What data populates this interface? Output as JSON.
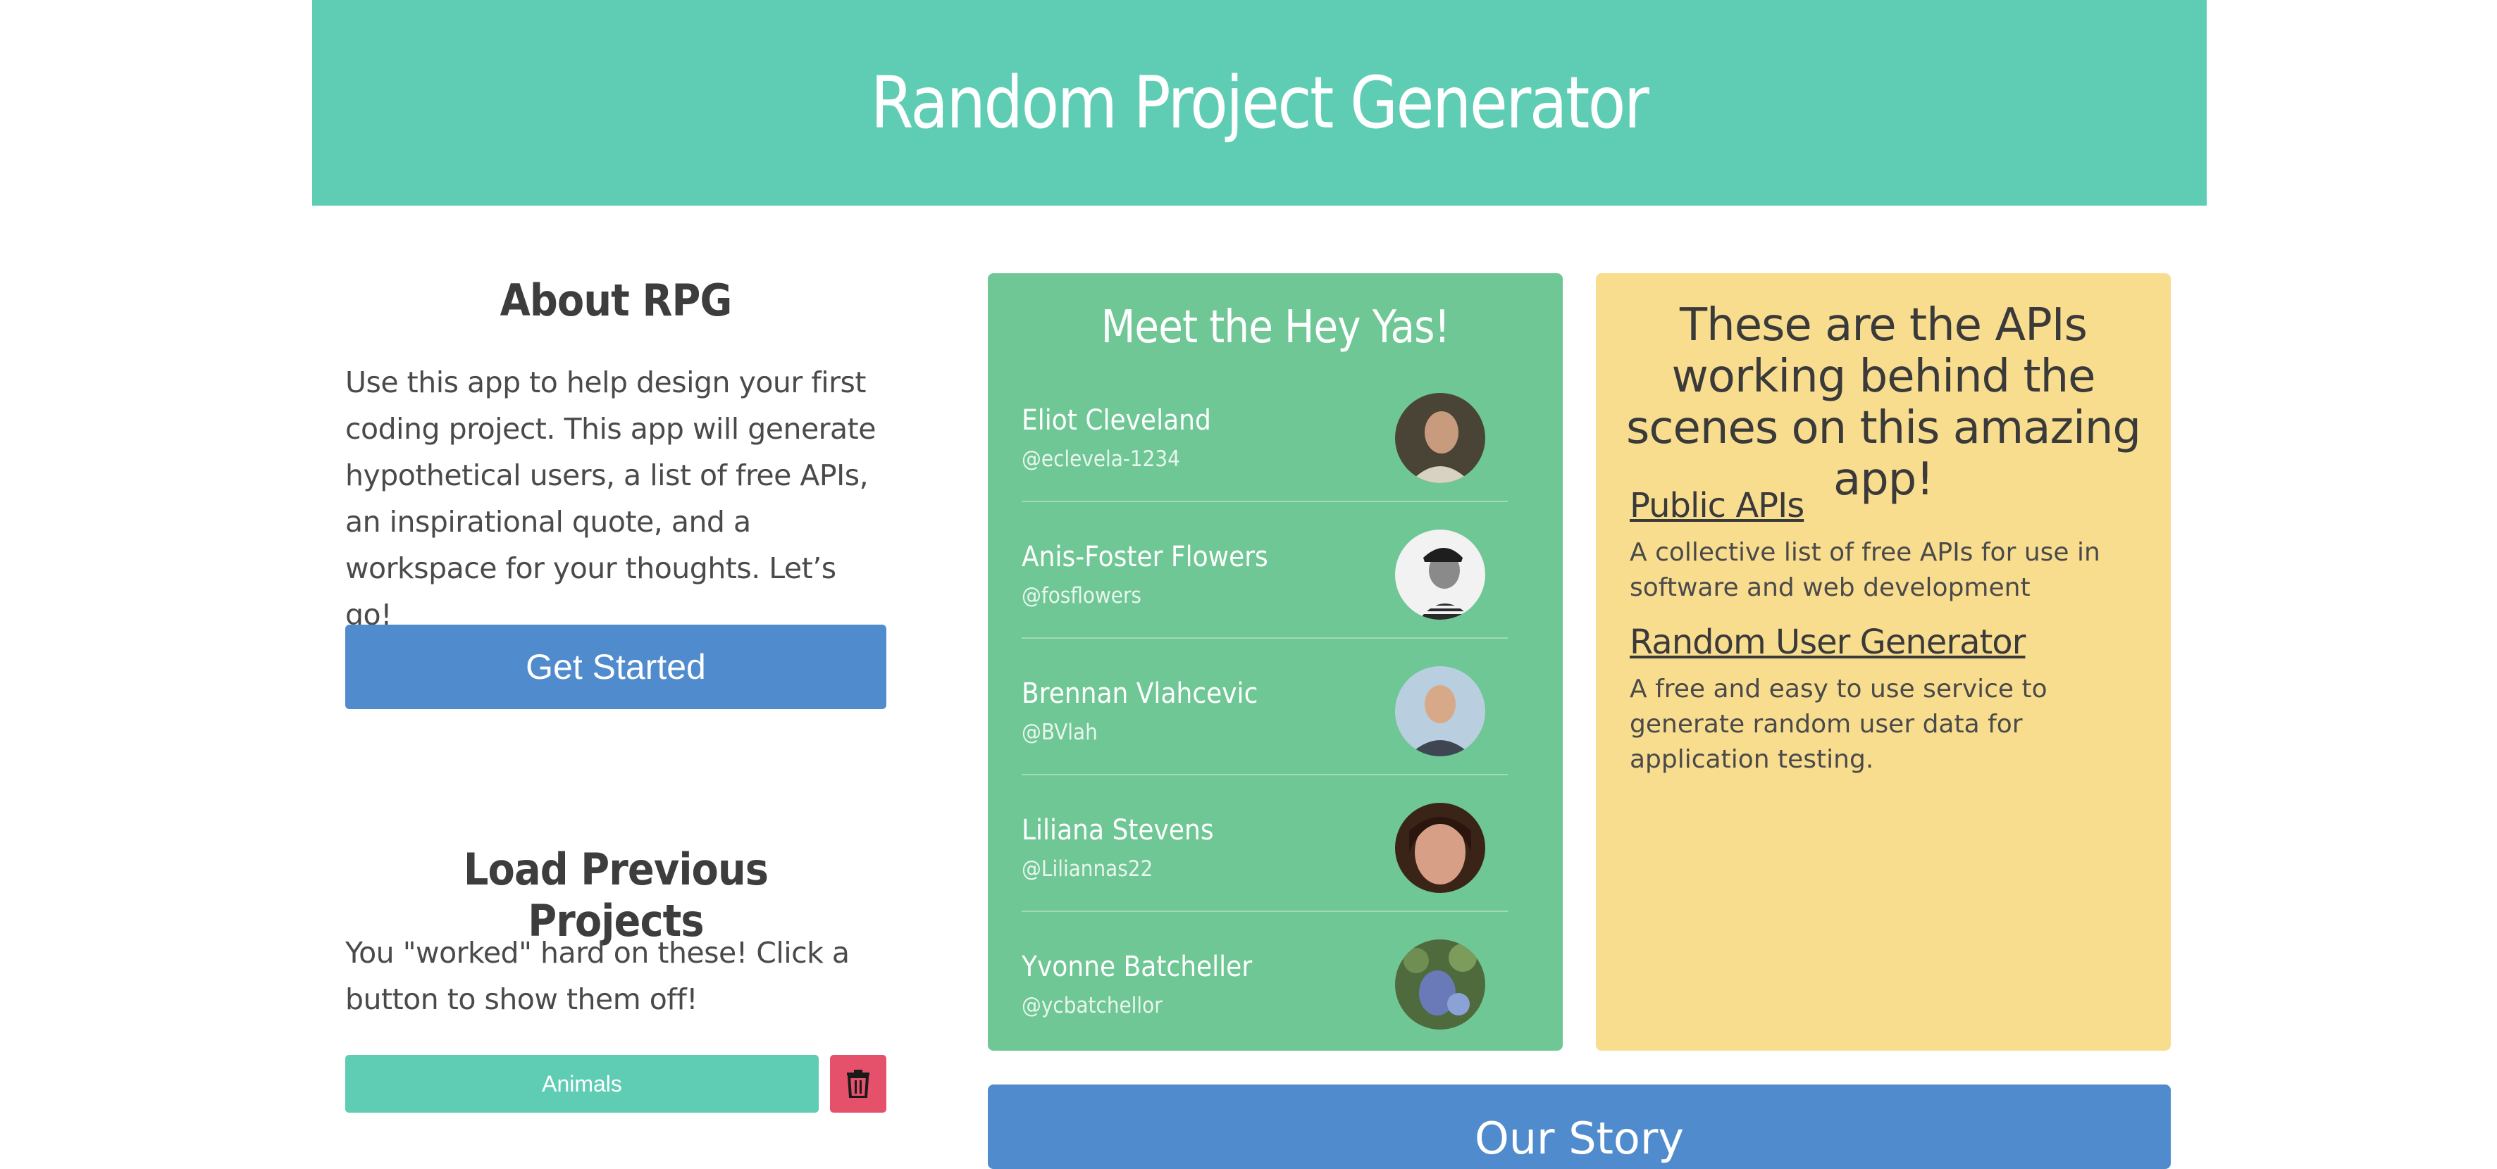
{
  "header": {
    "title": "Random Project Generator"
  },
  "about": {
    "title": "About RPG",
    "text": "Use this app to help design your first coding project. This app will generate hypothetical users, a list of free APIs, an inspirational quote, and a workspace for your thoughts. Let’s go!",
    "button": "Get Started"
  },
  "load": {
    "title": "Load Previous Projects",
    "text": "You \"worked\" hard on these! Click a button to show them off!",
    "projects": [
      {
        "label": "Animals",
        "delete_icon": "trash-icon"
      }
    ]
  },
  "team": {
    "title": "Meet the Hey Yas!",
    "members": [
      {
        "name": "Eliot Cleveland",
        "handle": "@eclevela-1234"
      },
      {
        "name": "Anis-Foster Flowers",
        "handle": "@fosflowers"
      },
      {
        "name": "Brennan Vlahcevic",
        "handle": "@BVlah"
      },
      {
        "name": "Liliana Stevens",
        "handle": "@Liliannas22"
      },
      {
        "name": "Yvonne Batcheller",
        "handle": "@ycbatchellor"
      }
    ]
  },
  "apis": {
    "title": "These are the APIs working behind the scenes on this amazing app!",
    "items": [
      {
        "name": "Public APIs",
        "desc": "A collective list of free APIs for use in software and web development"
      },
      {
        "name": "Random User Generator",
        "desc": "A free and easy to use service to generate random user data for application testing."
      }
    ]
  },
  "story": {
    "title": "Our Story"
  },
  "colors": {
    "teal": "#5ecdb4",
    "green": "#6ec794",
    "yellow": "#f9dd8f",
    "blue": "#508ccd",
    "red": "#e5506b"
  }
}
